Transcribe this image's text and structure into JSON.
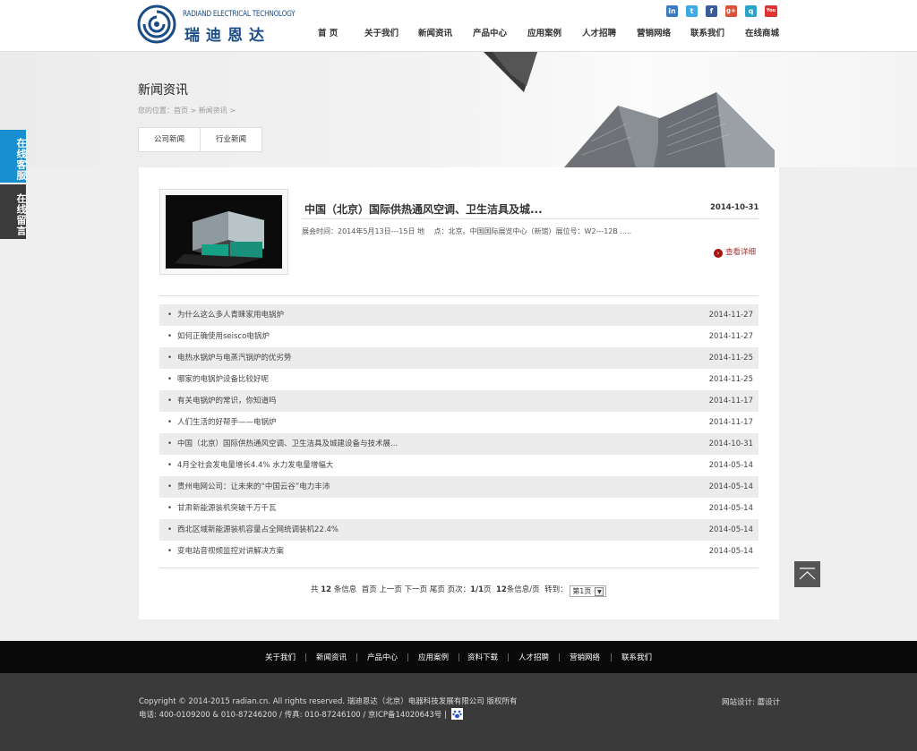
{
  "header": {
    "logo_en": "RADIAND ELECTRICAL TECHNOLOGY",
    "logo_cn": "瑞迪恩达",
    "nav": [
      "首 页",
      "关于我们",
      "新闻资讯",
      "产品中心",
      "应用案例",
      "人才招聘",
      "营销网络",
      "联系我们",
      "在线商城"
    ],
    "social": [
      {
        "icon": "linkedin-icon",
        "glyph": "in",
        "color": "#3a7bbf"
      },
      {
        "icon": "twitter-icon",
        "glyph": "t",
        "color": "#3fa9e6"
      },
      {
        "icon": "facebook-icon",
        "glyph": "f",
        "color": "#3b5b99"
      },
      {
        "icon": "google-plus-icon",
        "glyph": "g+",
        "color": "#d9533b"
      },
      {
        "icon": "qq-icon",
        "glyph": "q",
        "color": "#2ba3c7"
      },
      {
        "icon": "youtube-icon",
        "glyph": "You",
        "color": "#d33"
      }
    ]
  },
  "banner": {
    "page_title": "新闻资讯",
    "breadcrumb": "您的位置：首页 > 新闻资讯 >",
    "tabs": [
      "公司新闻",
      "行业新闻"
    ]
  },
  "side": {
    "service": "在线客服",
    "message": "在线留言"
  },
  "featured": {
    "title": "中国（北京）国际供热通风空调、卫生洁具及城...",
    "date": "2014-10-31",
    "desc": "展会时间：2014年5月13日---15日 地　 点：北京。中国国际展览中心（新馆）展位号：W2---12B .....",
    "more": "查看详细"
  },
  "news": [
    {
      "title": "为什么这么多人青睐家用电锅炉",
      "date": "2014-11-27"
    },
    {
      "title": "如何正确使用seisco电锅炉",
      "date": "2014-11-27"
    },
    {
      "title": "电热水锅炉与电蒸汽锅炉的优劣势",
      "date": "2014-11-25"
    },
    {
      "title": "哪家的电锅炉设备比较好呢",
      "date": "2014-11-25"
    },
    {
      "title": "有关电锅炉的常识，你知道吗",
      "date": "2014-11-17"
    },
    {
      "title": "人们生活的好帮手——电锅炉",
      "date": "2014-11-17"
    },
    {
      "title": "中国（北京）国际供热通风空调、卫生洁具及城建设备与技术展...",
      "date": "2014-10-31"
    },
    {
      "title": "4月全社会发电量增长4.4% 水力发电量增幅大",
      "date": "2014-05-14"
    },
    {
      "title": "贵州电网公司：让未来的“中国云谷”电力丰沛",
      "date": "2014-05-14"
    },
    {
      "title": "甘肃新能源装机突破千万千瓦",
      "date": "2014-05-14"
    },
    {
      "title": "西北区域新能源装机容量占全网统调装机22.4%",
      "date": "2014-05-14"
    },
    {
      "title": "变电站音视频监控对讲解决方案",
      "date": "2014-05-14"
    }
  ],
  "pager": {
    "total_prefix": "共",
    "total": "12",
    "total_suffix": "条信息",
    "first": "首页",
    "prev": "上一页",
    "next": "下一页",
    "last": "尾页",
    "page_label": "页次：",
    "page_value": "1/1",
    "page_unit": "页",
    "per_page_value": "12",
    "per_page_suffix": "条信息/页",
    "goto_label": "转到：",
    "select_value": "第1页"
  },
  "footer": {
    "nav": [
      "关于我们",
      "新闻资讯",
      "产品中心",
      "应用案例",
      "资料下载",
      "人才招聘",
      "营销网络",
      "联系我们"
    ],
    "copyright": "Copyright © 2014-2015 radian.cn. All rights reserved. 瑞迪恩达（北京）电器科技发展有限公司 版权所有",
    "contact": "电话: 400-0109200 & 010-87246200  /  传真: 010-87246100  /  京ICP备14020643号 |",
    "design": "网站设计: 蘑设计"
  }
}
